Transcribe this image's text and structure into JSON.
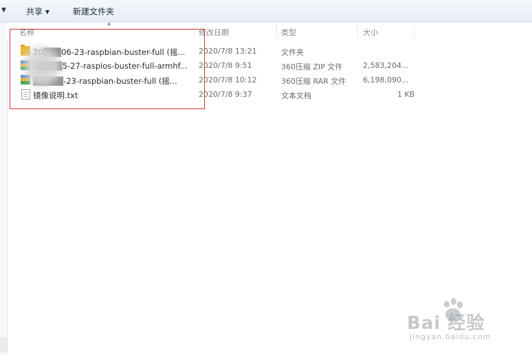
{
  "toolbar": {
    "share_label": "共享 ▾",
    "new_folder_label": "新建文件夹"
  },
  "columns": {
    "name": "名称",
    "date": "修改日期",
    "type": "类型",
    "size": "大小"
  },
  "files": [
    {
      "name": "20▒▒▒06-23-raspbian-buster-full (摇...",
      "date": "2020/7/8 13:21",
      "type": "文件夹",
      "size": "",
      "icon": "folder-icon"
    },
    {
      "name": "2▒▒▒▒5-27-raspios-buster-full-armhf...",
      "date": "2020/7/8 9:51",
      "type": "360压缩 ZIP 文件",
      "size": "2,583,204...",
      "icon": "zip-archive-icon"
    },
    {
      "name": "▒▒▒▒▒-23-raspbian-buster-full (摇...",
      "date": "2020/7/8 10:12",
      "type": "360压缩 RAR 文件",
      "size": "6,198,090...",
      "icon": "rar-archive-icon"
    },
    {
      "name": "镜像说明.txt",
      "date": "2020/7/8 9:37",
      "type": "文本文档",
      "size": "1 KB",
      "icon": "text-file-icon"
    }
  ],
  "watermark": {
    "brand": "Bai  经验",
    "url": "jingyan.baidu.com"
  }
}
